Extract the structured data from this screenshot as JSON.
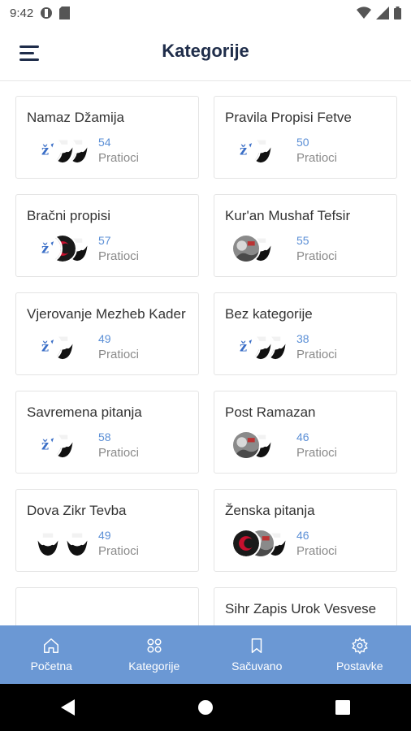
{
  "status_bar": {
    "time": "9:42"
  },
  "app_bar": {
    "title": "Kategorije"
  },
  "followers_label": "Pratioci",
  "categories_left": [
    {
      "title": "Namaz Džamija",
      "count": "54",
      "avatars": [
        "logo",
        "beard",
        "beard"
      ]
    },
    {
      "title": "Bračni propisi",
      "count": "57",
      "avatars": [
        "logo",
        "red",
        "beard"
      ]
    },
    {
      "title": "Vjerovanje Mezheb Kader",
      "count": "49",
      "avatars": [
        "logo",
        "beard"
      ]
    },
    {
      "title": "Savremena pitanja",
      "count": "58",
      "avatars": [
        "logo",
        "beard"
      ]
    },
    {
      "title": "Dova Zikr Tevba",
      "count": "49",
      "avatars": [
        "beard",
        "gap",
        "beard"
      ]
    },
    {
      "title": "",
      "count": "",
      "avatars": []
    }
  ],
  "categories_right": [
    {
      "title": "Pravila Propisi Fetve",
      "count": "50",
      "avatars": [
        "logo",
        "beard"
      ]
    },
    {
      "title": "Kur'an Mushaf Tefsir",
      "count": "55",
      "avatars": [
        "photo",
        "beard"
      ]
    },
    {
      "title": "Bez kategorije",
      "count": "38",
      "avatars": [
        "logo",
        "beard",
        "beard"
      ]
    },
    {
      "title": "Post Ramazan",
      "count": "46",
      "avatars": [
        "photo",
        "beard"
      ]
    },
    {
      "title": "Ženska pitanja",
      "count": "46",
      "avatars": [
        "red",
        "photo",
        "beard"
      ]
    },
    {
      "title": "Sihr Zapis Urok Vesvese",
      "count": "",
      "avatars": []
    }
  ],
  "bottom_nav": [
    {
      "label": "Početna",
      "icon": "home-icon"
    },
    {
      "label": "Kategorije",
      "icon": "grid-icon"
    },
    {
      "label": "Sačuvano",
      "icon": "bookmark-icon"
    },
    {
      "label": "Postavke",
      "icon": "gear-icon"
    }
  ],
  "colors": {
    "primary": "#1f2d4a",
    "nav_bg": "#6b98d4",
    "count": "#5b8fd6",
    "label": "#8a8a8a"
  }
}
